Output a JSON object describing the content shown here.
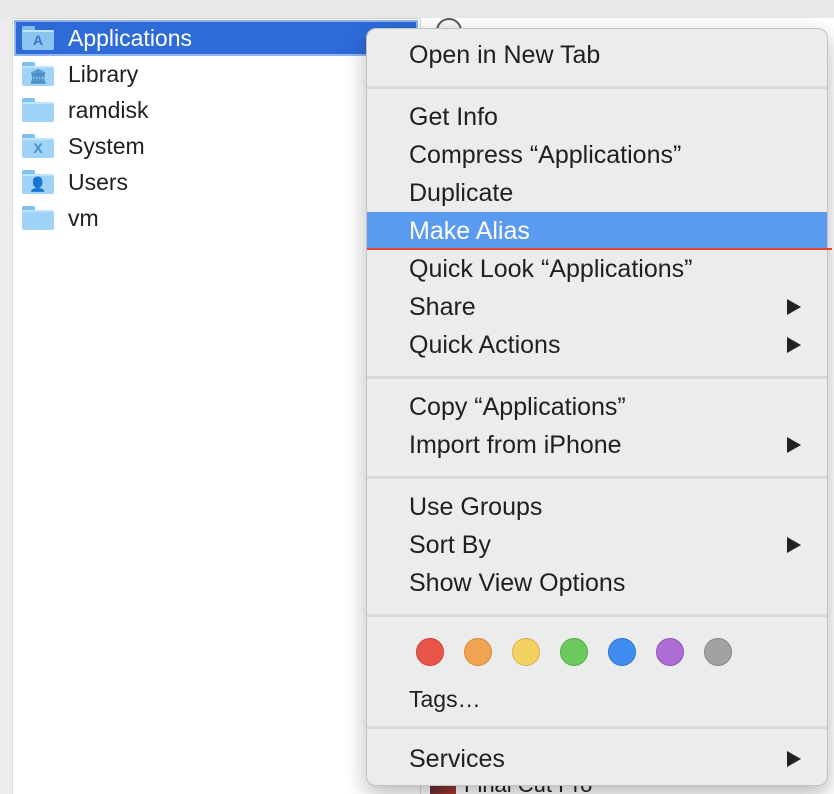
{
  "files": [
    {
      "name": "Applications",
      "icon": "applications-folder-icon",
      "glyph": "A"
    },
    {
      "name": "Library",
      "icon": "library-folder-icon",
      "glyph": "🏛"
    },
    {
      "name": "ramdisk",
      "icon": "folder-icon",
      "glyph": ""
    },
    {
      "name": "System",
      "icon": "system-folder-icon",
      "glyph": "X"
    },
    {
      "name": "Users",
      "icon": "users-folder-icon",
      "glyph": "👤"
    },
    {
      "name": "vm",
      "icon": "folder-icon",
      "glyph": ""
    }
  ],
  "menu": {
    "open_new_tab": "Open in New Tab",
    "get_info": "Get Info",
    "compress": "Compress “Applications”",
    "duplicate": "Duplicate",
    "make_alias": "Make Alias",
    "quick_look": "Quick Look “Applications”",
    "share": "Share",
    "quick_actions": "Quick Actions",
    "copy": "Copy “Applications”",
    "import_iphone": "Import from iPhone",
    "use_groups": "Use Groups",
    "sort_by": "Sort By",
    "show_view_options": "Show View Options",
    "tags": "Tags…",
    "services": "Services"
  },
  "tag_colors": [
    {
      "name": "red",
      "fill": "#e8554b",
      "stroke": "#c9433a"
    },
    {
      "name": "orange",
      "fill": "#f0a350",
      "stroke": "#d28a3b"
    },
    {
      "name": "yellow",
      "fill": "#f4d163",
      "stroke": "#d4b24c"
    },
    {
      "name": "green",
      "fill": "#6cc95e",
      "stroke": "#55ad49"
    },
    {
      "name": "blue",
      "fill": "#3f8df0",
      "stroke": "#2f73cf"
    },
    {
      "name": "purple",
      "fill": "#ad6dd4",
      "stroke": "#9156b6"
    },
    {
      "name": "gray",
      "fill": "#a2a2a4",
      "stroke": "#878789"
    }
  ],
  "background_app": "Final Cut Pro"
}
